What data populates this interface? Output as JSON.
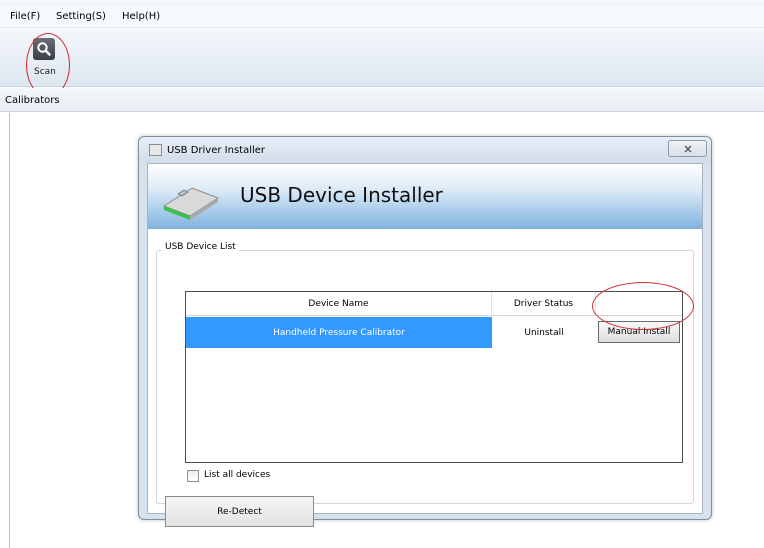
{
  "menu": {
    "file": "File(F)",
    "setting": "Setting(S)",
    "help": "Help(H)"
  },
  "toolbar": {
    "scan_label": "Scan",
    "scan_icon": "search-icon"
  },
  "section": {
    "title": "Calibrators"
  },
  "dialog": {
    "title": "USB Driver Installer",
    "close_icon": "close-icon",
    "banner_title": "USB Device Installer",
    "group_label": "USB Device List",
    "columns": [
      "Device Name",
      "Driver Status",
      ""
    ],
    "rows": [
      {
        "device_name": "Handheld Pressure Calibrator",
        "driver_status": "Uninstall",
        "action_label": "Manual Install"
      }
    ],
    "list_all_devices": {
      "label": "List all devices",
      "checked": false
    },
    "redetect_label": "Re-Detect"
  },
  "colors": {
    "selection": "#3399ff",
    "annotation_red": "#d23030"
  }
}
